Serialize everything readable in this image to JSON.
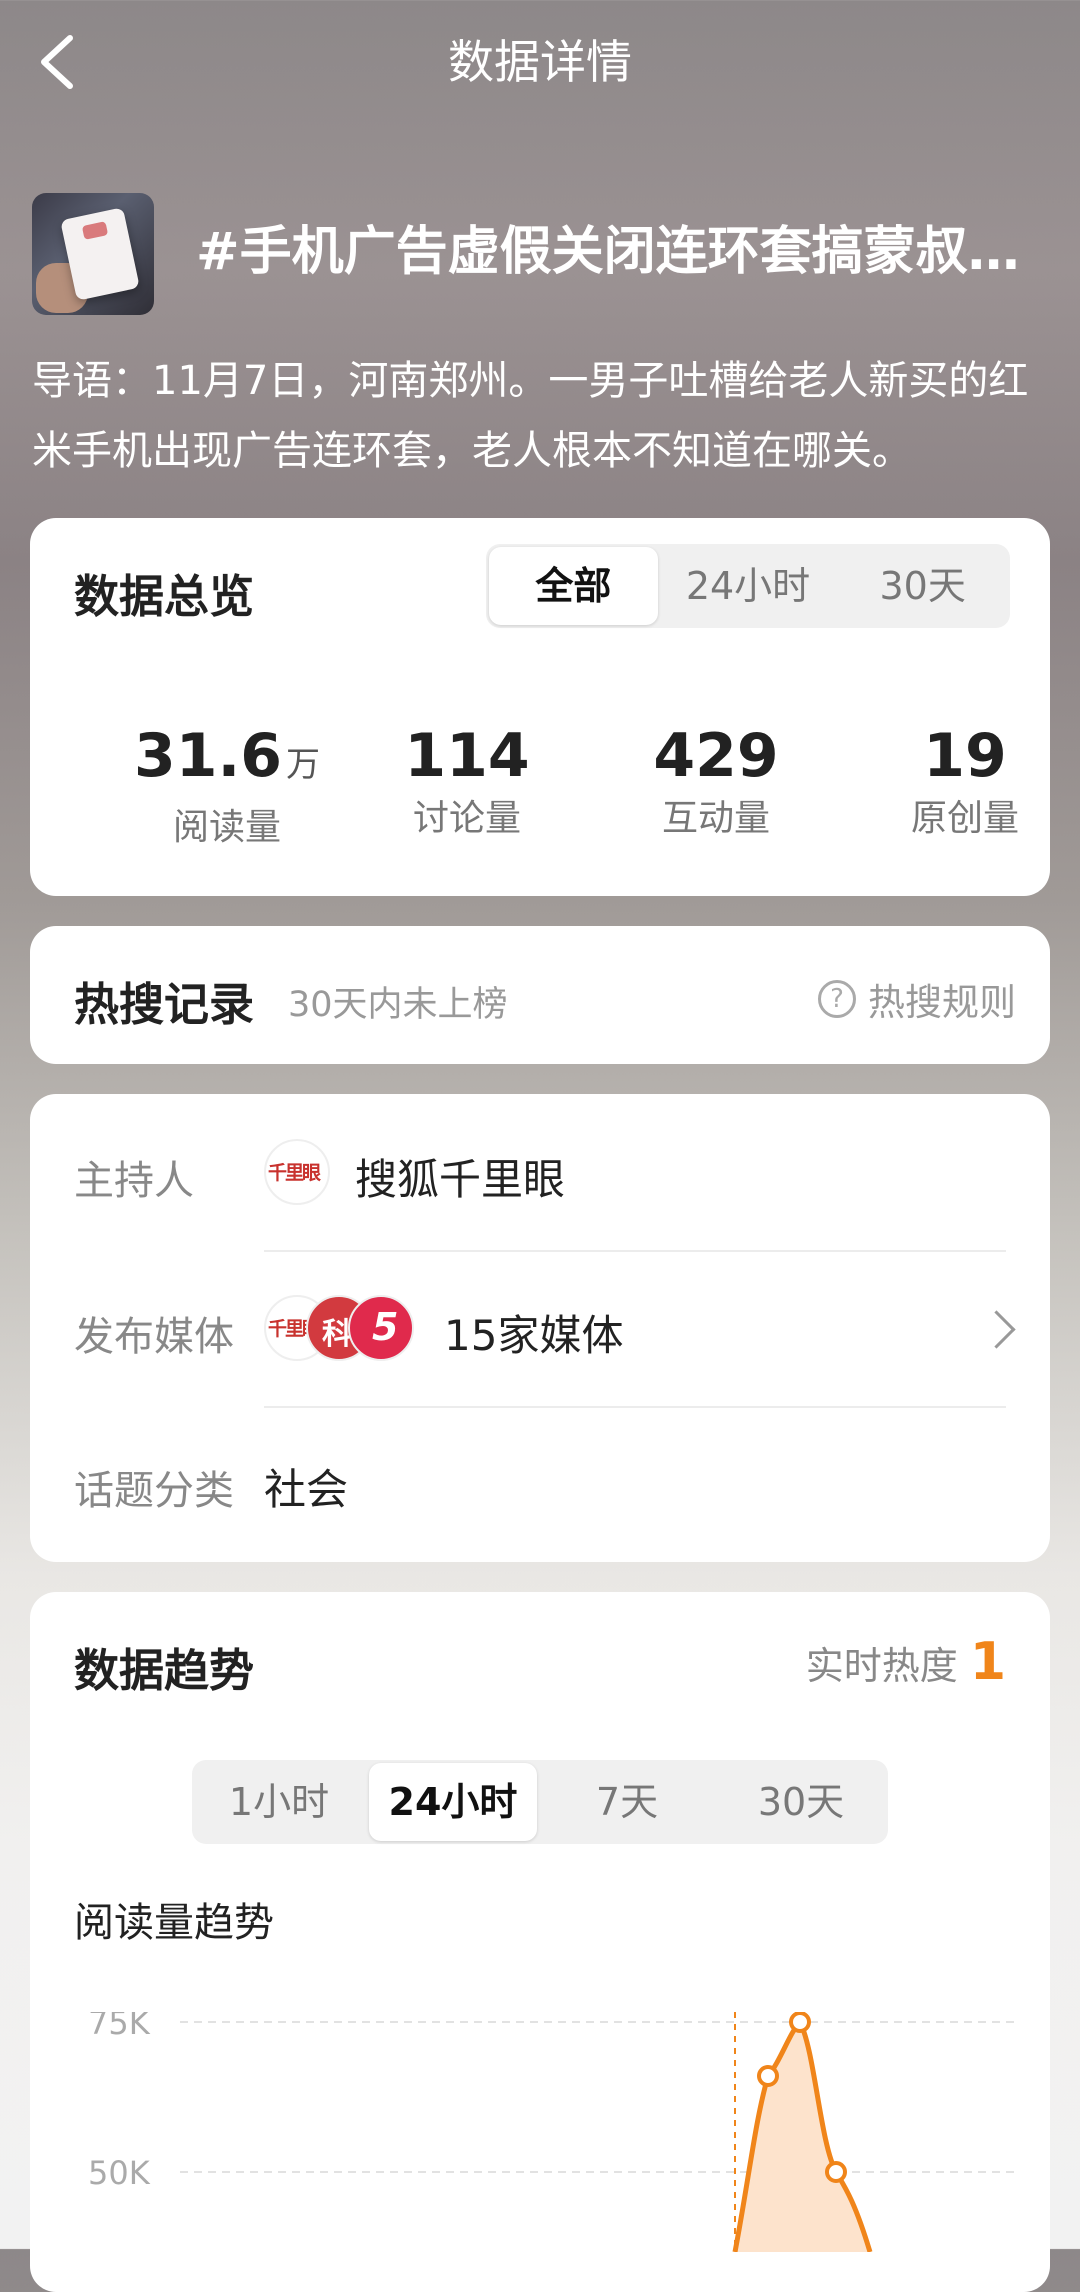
{
  "header": {
    "title": "数据详情",
    "back_icon": "chevron-left-icon"
  },
  "topic": {
    "title": "#手机广告虚假关闭连环套搞蒙叔…",
    "intro": "导语：11月7日，河南郑州。一男子吐槽给老人新买的红米手机出现广告连环套，老人根本不知道在哪关。"
  },
  "overview": {
    "title": "数据总览",
    "tabs": [
      "全部",
      "24小时",
      "30天"
    ],
    "active_tab": "全部",
    "stats": [
      {
        "value": "31.6",
        "unit": "万",
        "label": "阅读量"
      },
      {
        "value": "114",
        "unit": "",
        "label": "讨论量"
      },
      {
        "value": "429",
        "unit": "",
        "label": "互动量"
      },
      {
        "value": "19",
        "unit": "",
        "label": "原创量"
      }
    ]
  },
  "hot_search": {
    "title": "热搜记录",
    "status": "30天内未上榜",
    "rule_label": "热搜规则"
  },
  "info": {
    "host_label": "主持人",
    "host_name": "搜狐千里眼",
    "media_label": "发布媒体",
    "media_count": "15家媒体",
    "category_label": "话题分类",
    "category": "社会"
  },
  "trend": {
    "title": "数据趋势",
    "heat_label": "实时热度",
    "heat_value": "1",
    "ranges": [
      "1小时",
      "24小时",
      "7天",
      "30天"
    ],
    "active_range": "24小时",
    "chart_title": "阅读量趋势",
    "accent": "#f0851a"
  },
  "chart_data": {
    "type": "area",
    "title": "阅读量趋势",
    "yticks": [
      "75K",
      "50K"
    ],
    "ylim": [
      0,
      80000
    ],
    "grid": true,
    "series": [
      {
        "values": [
          0,
          0,
          0,
          66000,
          75000,
          50000,
          40000
        ]
      }
    ]
  }
}
